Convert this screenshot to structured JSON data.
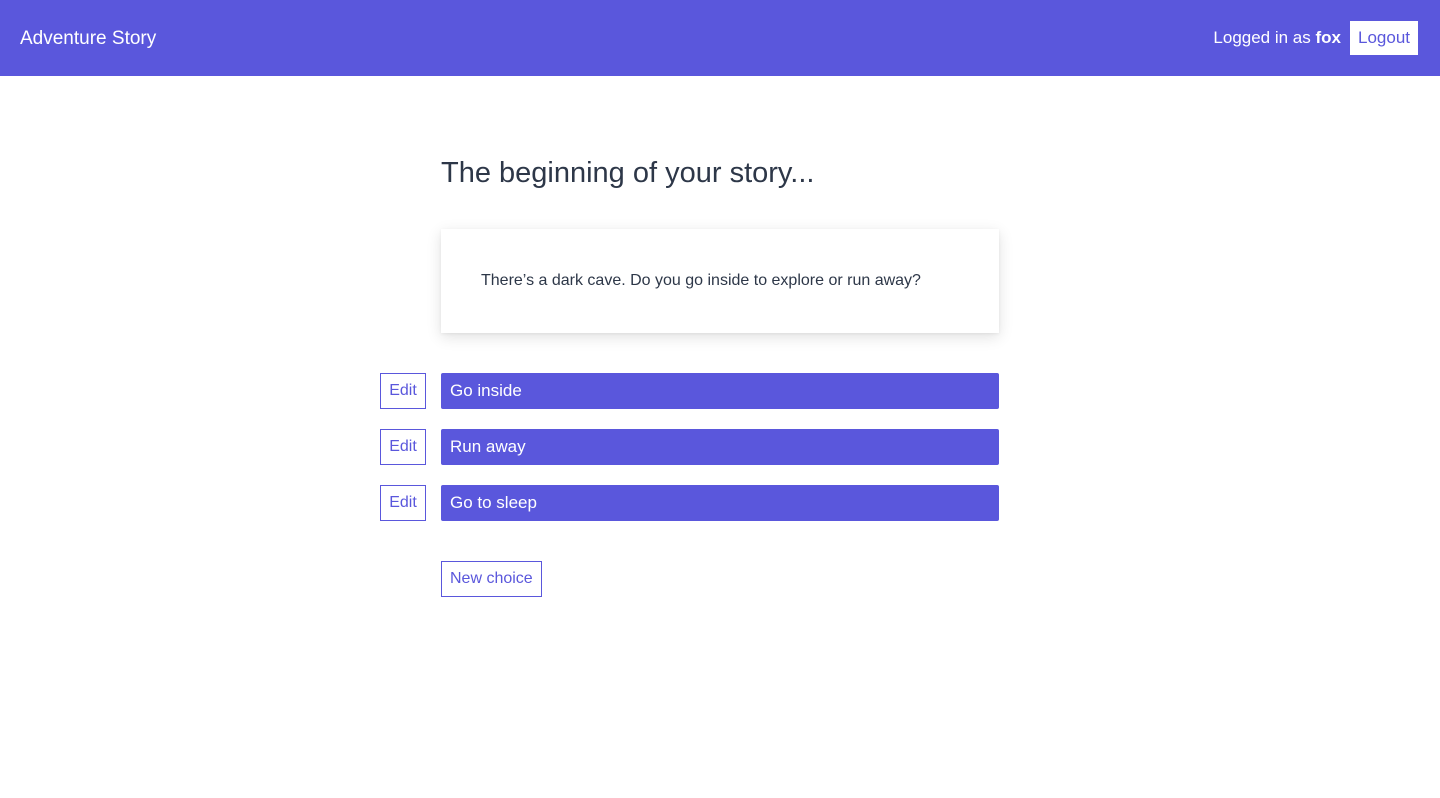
{
  "navbar": {
    "brand": "Adventure Story",
    "logged_in_prefix": "Logged in as ",
    "username": "fox",
    "logout_label": "Logout"
  },
  "page": {
    "heading": "The beginning of your story...",
    "story_text": "There’s a dark cave. Do you go inside to explore or run away?"
  },
  "choices": [
    {
      "edit_label": "Edit",
      "label": "Go inside"
    },
    {
      "edit_label": "Edit",
      "label": "Run away"
    },
    {
      "edit_label": "Edit",
      "label": "Go to sleep"
    }
  ],
  "new_choice_label": "New choice",
  "colors": {
    "accent": "#5a57dc",
    "text": "#2d3748",
    "background": "#ffffff"
  }
}
